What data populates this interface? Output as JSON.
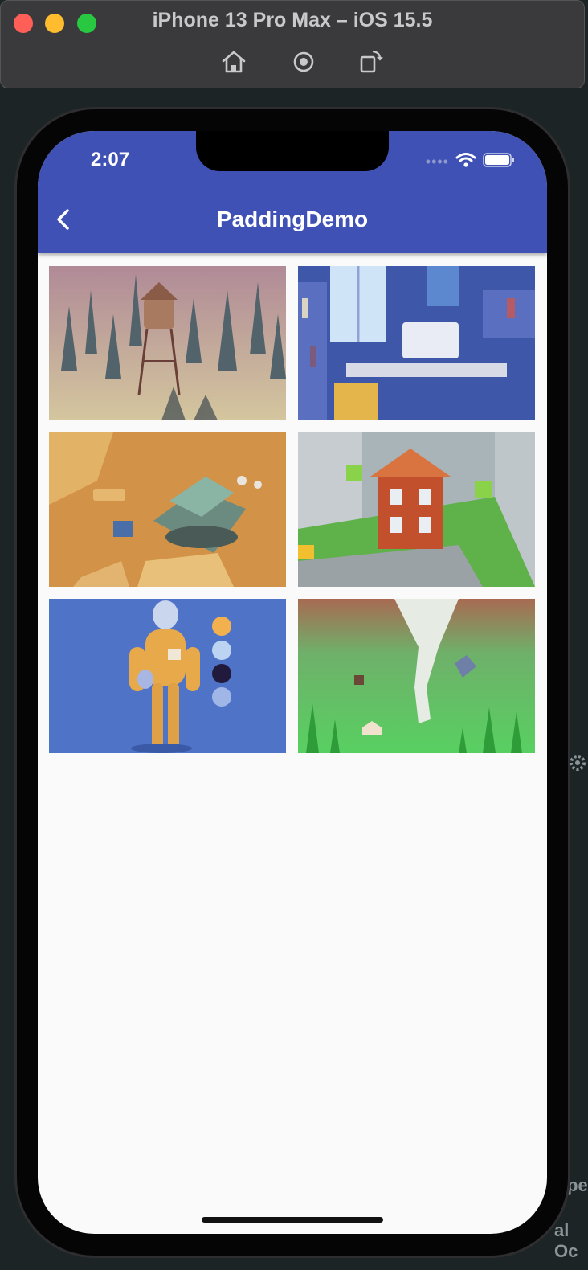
{
  "simulator": {
    "title": "iPhone 13 Pro Max – iOS 15.5",
    "tools": [
      "home-icon",
      "screenshot-icon",
      "rotate-icon"
    ]
  },
  "background": {
    "text_fragment_1": "pe",
    "text_fragment_2": "al Oc"
  },
  "status_bar": {
    "time": "2:07",
    "icons": [
      "cellular-dots-icon",
      "wifi-icon",
      "battery-icon"
    ]
  },
  "app_bar": {
    "title": "PaddingDemo",
    "back_icon": "chevron-left-icon",
    "color": "#3f51b5"
  },
  "gallery": {
    "images": [
      {
        "name": "gravity-falls-water-tower-image"
      },
      {
        "name": "desk-room-image"
      },
      {
        "name": "desert-tank-image"
      },
      {
        "name": "red-house-image"
      },
      {
        "name": "astronaut-character-image"
      },
      {
        "name": "tornado-field-image"
      }
    ]
  }
}
